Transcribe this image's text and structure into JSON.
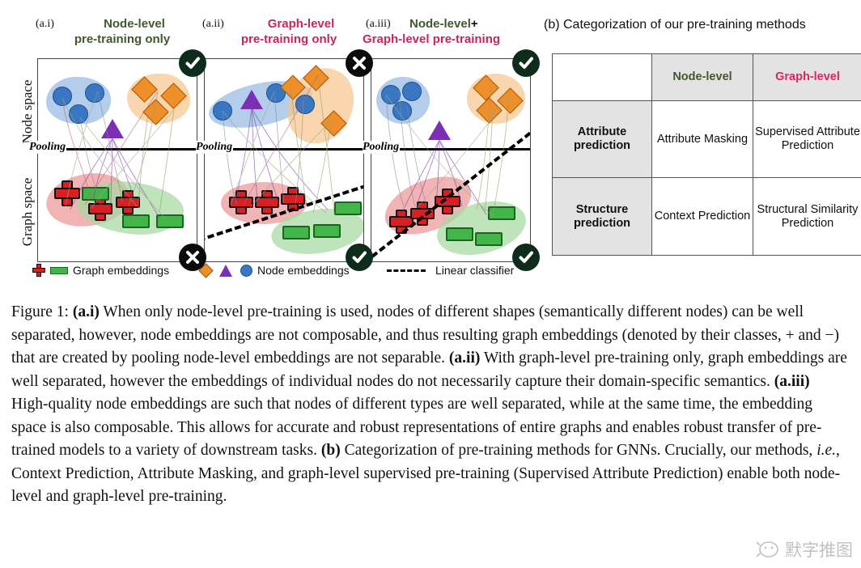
{
  "figure": {
    "panels": [
      {
        "tag": "(a.i)",
        "title_line1": "Node-level",
        "title_line2": "pre-training only",
        "title_part_node": "Node-level",
        "title_part_plus": "",
        "title_part_graph": "",
        "top_badge": "check",
        "bottom_badge": "cross",
        "has_classifier": false
      },
      {
        "tag": "(a.ii)",
        "title_line1": "Graph-level",
        "title_line2": "pre-training only",
        "top_badge": "cross",
        "bottom_badge": "check",
        "has_classifier": true
      },
      {
        "tag": "(a.iii)",
        "title_line1": "Node-level",
        "title_plus": "+",
        "title_line2": "Graph-level pre-training",
        "top_badge": "check",
        "bottom_badge": "check",
        "has_classifier": true
      }
    ],
    "axis_labels": {
      "node_space": "Node space",
      "graph_space": "Graph space"
    },
    "pooling_label": "Pooling",
    "legend": [
      {
        "name": "graph-embeddings",
        "label": "Graph embeddings",
        "icons": [
          "plus-icon",
          "bar-icon"
        ]
      },
      {
        "name": "node-embeddings",
        "label": "Node embeddings",
        "icons": [
          "diamond-icon",
          "triangle-icon",
          "circle-icon"
        ]
      },
      {
        "name": "linear-classifier",
        "label": "Linear classifier",
        "icons": [
          "dashed-line-icon"
        ]
      }
    ]
  },
  "categorization": {
    "title": "(b) Categorization of our pre-training methods",
    "corner": "",
    "columns": [
      "Node-level",
      "Graph-level"
    ],
    "rows": [
      {
        "header": "Attribute prediction",
        "header_line1": "Attribute",
        "header_line2": "prediction",
        "cells": [
          "Attribute Masking",
          "Supervised Attribute Prediction"
        ]
      },
      {
        "header": "Structure prediction",
        "header_line1": "Structure",
        "header_line2": "prediction",
        "cells": [
          "Context Prediction",
          "Structural Similarity Prediction"
        ]
      }
    ]
  },
  "caption": {
    "label": "Figure 1:",
    "t1": "(a.i)",
    "s1": " When only node-level pre-training is used, nodes of different shapes (semantically different nodes) can be well separated, however, node embeddings are not composable, and thus resulting graph embeddings (denoted by their classes, + and −) that are created by pooling node-level embeddings are not separable. ",
    "t2": "(a.ii)",
    "s2": " With graph-level pre-training only, graph embeddings are well separated, however the embeddings of individual nodes do not necessarily capture their domain-specific semantics. ",
    "t3": "(a.iii)",
    "s3": " High-quality node embeddings are such that nodes of different types are well separated, while at the same time, the embedding space is also composable. This allows for accurate and robust representations of entire graphs and enables robust transfer of pre-trained models to a variety of downstream tasks. ",
    "t4": "(b)",
    "s4": " Categorization of pre-training methods for GNNs. Crucially, our methods, ",
    "ital": "i.e.",
    "s5": ", Context Prediction, Attribute Masking, and graph-level supervised pre-training (Supervised Attribute Prediction) enable both node-level and graph-level pre-training."
  },
  "watermark": {
    "text": "默字推图"
  },
  "colors": {
    "node_level": "#44572e",
    "graph_level": "#c8265a",
    "plus_red": "#d91f21",
    "bar_green": "#43b649",
    "circle_blue": "#3a77c2",
    "diamond_orange": "#ef8f2a",
    "triangle_purple": "#7b2fb5",
    "header_bg": "#e3e3e3"
  }
}
